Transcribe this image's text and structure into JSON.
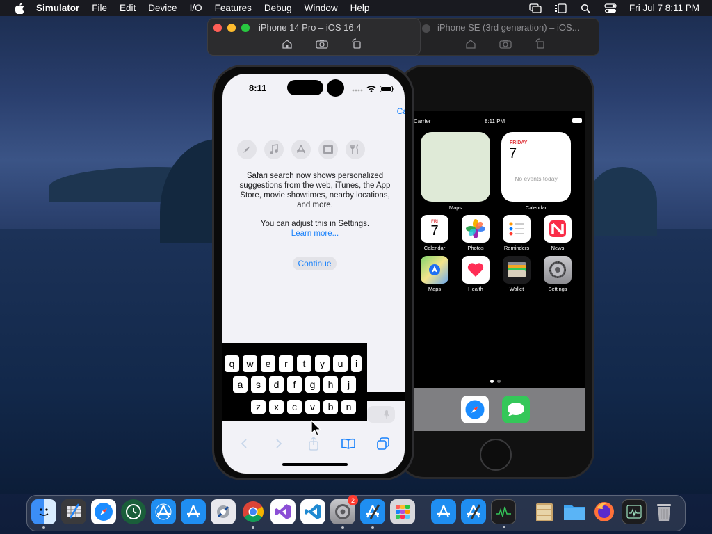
{
  "menubar": {
    "app_name": "Simulator",
    "items": [
      "File",
      "Edit",
      "Device",
      "I/O",
      "Features",
      "Debug",
      "Window",
      "Help"
    ],
    "clock": "Fri Jul 7  8:11 PM"
  },
  "window_primary": {
    "title": "iPhone 14 Pro – iOS 16.4"
  },
  "window_secondary": {
    "title": "iPhone SE (3rd generation) – iOS..."
  },
  "phone_primary": {
    "time": "8:11",
    "cancel": "Ca",
    "categories": [
      "compass-icon",
      "music-icon",
      "app-store-icon",
      "film-icon",
      "fork-knife-icon"
    ],
    "info_line1": "Safari search now shows personalized suggestions from the web, iTunes, the App Store, movie showtimes, nearby locations, and more.",
    "info_line2": "You can adjust this in Settings.",
    "learn_more": "Learn more...",
    "continue": "Continue",
    "keyboard": {
      "row1": [
        "q",
        "w",
        "e",
        "r",
        "t",
        "y",
        "u",
        "i"
      ],
      "row2": [
        "a",
        "s",
        "d",
        "f",
        "g",
        "h",
        "j"
      ],
      "row3": [
        "z",
        "x",
        "c",
        "v",
        "b",
        "n"
      ]
    }
  },
  "phone_secondary": {
    "carrier": "Carrier",
    "time": "8:11 PM",
    "widget_maps_label": "Maps",
    "widget_cal_label": "Calendar",
    "widget_cal_day": "FRIDAY",
    "widget_cal_date": "7",
    "widget_cal_empty": "No events today",
    "apps": [
      {
        "label": "Calendar",
        "icon": "calendar-icon",
        "top": "FRI",
        "num": "7"
      },
      {
        "label": "Photos",
        "icon": "photos-icon"
      },
      {
        "label": "Reminders",
        "icon": "reminders-icon"
      },
      {
        "label": "News",
        "icon": "news-icon"
      },
      {
        "label": "Maps",
        "icon": "maps-icon"
      },
      {
        "label": "Health",
        "icon": "health-icon"
      },
      {
        "label": "Wallet",
        "icon": "wallet-icon"
      },
      {
        "label": "Settings",
        "icon": "settings-icon"
      }
    ],
    "dock": [
      "safari-icon",
      "messages-icon"
    ]
  },
  "dock": {
    "apps": [
      "finder-icon",
      "xcode-instruments-icon",
      "safari-icon",
      "time-machine-icon",
      "app-store-connect-icon",
      "app-store-icon",
      "xcode-utility-icon",
      "chrome-icon",
      "visual-studio-icon",
      "vscode-icon",
      "system-settings-icon",
      "xcode-icon",
      "launchpad-icon"
    ],
    "settings_badge": "2",
    "right_apps": [
      "app-store-icon",
      "xcode-icon",
      "activity-monitor-icon"
    ],
    "stack_apps": [
      "archive-icon",
      "folder-icon",
      "firefox-icon",
      "console-icon",
      "trash-icon"
    ]
  }
}
